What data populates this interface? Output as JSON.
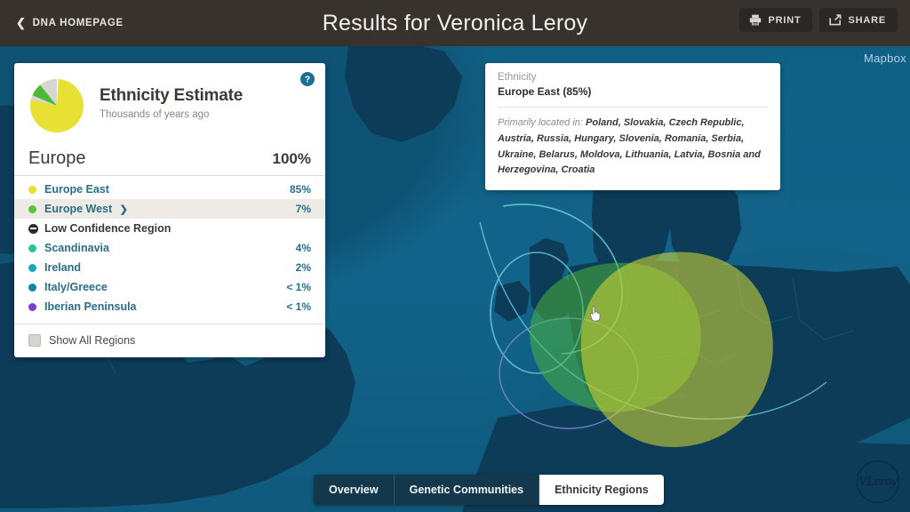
{
  "header": {
    "back_label": "DNA HOMEPAGE",
    "back_icon": "chevron-left-icon",
    "title": "Results for Veronica Leroy",
    "print_label": "PRINT",
    "print_icon": "printer-icon",
    "share_label": "SHARE",
    "share_icon": "share-icon",
    "background": "#37322d"
  },
  "panel": {
    "title": "Ethnicity Estimate",
    "subtitle": "Thousands of years ago",
    "help_icon": "question-mark-icon",
    "region_name": "Europe",
    "region_percent": "100%",
    "show_all_label": "Show All Regions",
    "ethnicities": [
      {
        "label": "Europe East",
        "percent": "85%",
        "color": "#e8e033",
        "has_chevron": false,
        "highlight": false,
        "type": "region"
      },
      {
        "label": "Europe West",
        "percent": "7%",
        "color": "#58c23a",
        "has_chevron": true,
        "chevron": "chevron-right-icon",
        "highlight": true,
        "type": "region"
      },
      {
        "label": "Low Confidence Region",
        "percent": "",
        "color": "#2e2b28",
        "has_chevron": false,
        "highlight": false,
        "type": "header"
      },
      {
        "label": "Scandinavia",
        "percent": "4%",
        "color": "#25c79a",
        "has_chevron": false,
        "highlight": false,
        "type": "region"
      },
      {
        "label": "Ireland",
        "percent": "2%",
        "color": "#17a8c0",
        "has_chevron": false,
        "highlight": false,
        "type": "region"
      },
      {
        "label": "Italy/Greece",
        "percent": "< 1%",
        "color": "#11879c",
        "has_chevron": false,
        "highlight": false,
        "type": "region"
      },
      {
        "label": "Iberian Peninsula",
        "percent": "< 1%",
        "color": "#7b3fd4",
        "has_chevron": false,
        "highlight": false,
        "type": "region"
      }
    ]
  },
  "chart_data": {
    "type": "pie",
    "title": "Ethnicity Estimate",
    "categories": [
      "Europe East",
      "Europe West",
      "Scandinavia",
      "Ireland",
      "Italy/Greece",
      "Iberian Peninsula"
    ],
    "values": [
      85,
      7,
      4,
      2,
      1,
      1
    ],
    "colors": [
      "#e8e033",
      "#58c23a",
      "#d8d6d2",
      "#d8d6d2",
      "#d8d6d2",
      "#d8d6d2"
    ],
    "legend_position": "right",
    "total_label": "100%"
  },
  "tooltip": {
    "kicker": "Ethnicity",
    "title": "Europe East (85%)",
    "lead": "Primarily located in:",
    "places": "Poland, Slovakia, Czech Republic, Austria, Russia, Hungary, Slovenia, Romania, Serbia, Ukraine, Belarus, Moldova, Lithuania, Latvia, Bosnia and Herzegovina, Croatia"
  },
  "tabs": [
    {
      "label": "Overview",
      "active": false
    },
    {
      "label": "Genetic Communities",
      "active": false
    },
    {
      "label": "Ethnicity Regions",
      "active": true
    }
  ],
  "map": {
    "attribution": "Mapbox",
    "watermark": "VLeroy",
    "cursor_icon": "pointer-cursor",
    "ocean_color": "#126184",
    "land_color": "#0c3c58",
    "region_blob_west_color": "#58c23a",
    "region_blob_east_color": "#d8dc33"
  }
}
